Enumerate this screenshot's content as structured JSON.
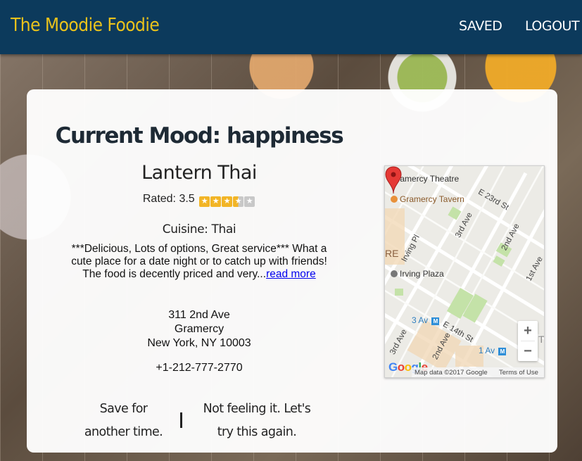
{
  "header": {
    "brand": "The Moodie Foodie",
    "nav": {
      "saved": "SAVED",
      "logout": "LOGOUT"
    }
  },
  "result": {
    "mood_heading": "Current Mood: happiness",
    "restaurant_name": "Lantern Thai",
    "rating_label": "Rated: 3.5",
    "rating_value": 3.5,
    "rating_max": 5,
    "cuisine": "Cuisine: Thai",
    "description": "***Delicious, Lots of options, Great service*** What a cute place for a date night or to catch up with friends! The food is decently priced and very...",
    "read_more": "read more",
    "address": [
      "311 2nd Ave",
      "Gramercy",
      "New York, NY 10003"
    ],
    "phone": "+1-212-777-2770",
    "actions": {
      "save_line1": "Save for",
      "save_line2": "another time.",
      "retry_line1": "Not feeling it. Let's",
      "retry_line2": "try this again."
    }
  },
  "map": {
    "labels": {
      "theatre": "Gramercy Theatre",
      "tavern": "Gramercy Tavern",
      "e23rd": "E 23rd St",
      "third_ave": "3rd Ave",
      "second_ave": "2nd Ave",
      "irving_pl": "Irving Pl",
      "re": "RE",
      "irving_plaza": "Irving Plaza",
      "first_ave": "1st Ave",
      "three_av": "3 Av",
      "e14th": "E 14th St",
      "third_ave_b": "3rd Ave",
      "second_ave_b": "2nd Ave",
      "one_av": "1 Av",
      "t": "T",
      "metro": "M"
    },
    "zoom_in": "+",
    "zoom_out": "−",
    "google": "Google",
    "map_data": "Map data ©2017 Google",
    "terms": "Terms of Use"
  },
  "colors": {
    "navbar": "#0c3a5c",
    "brand": "#e9c21c",
    "star": "#f2b526",
    "link": "#0000ee"
  }
}
